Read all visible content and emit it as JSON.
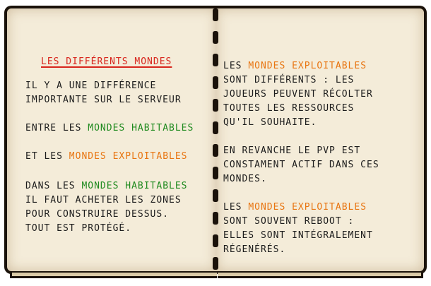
{
  "left_page": {
    "title": "Les différents mondes",
    "line1": "il y a une différence",
    "line2": "importante sur le serveur",
    "line3_prefix": "entre les ",
    "line3_highlight": "mondes habitables",
    "line4_prefix": "et les ",
    "line4_highlight": "mondes exploitables",
    "line5_prefix": "dans les ",
    "line5_highlight": "mondes habitables",
    "line6": "il faut acheter les zones",
    "line7": "pour construire dessus.",
    "line8": "tout est protégé."
  },
  "right_page": {
    "p1_prefix": "les ",
    "p1_highlight": "mondes exploitables",
    "p1_line2": "sont différents : les",
    "p1_line3": "joueurs peuvent récolter",
    "p1_line4": "toutes les ressources",
    "p1_line5": "qu'il souhaite.",
    "p2_line1": "en revanche le pvp est",
    "p2_line2": "constament actif dans ces",
    "p2_line3": "mondes.",
    "p3_prefix": "les ",
    "p3_highlight": "mondes exploitables",
    "p3_line2": "sont souvent reboot :",
    "p3_line3": "elles sont intégralement",
    "p3_line4": "régenérés."
  },
  "colors": {
    "title": "#d8241c",
    "habitable": "#1f8a1f",
    "exploitable": "#e87511",
    "paper": "#f4ecd9",
    "ink": "#1c1c1c"
  }
}
